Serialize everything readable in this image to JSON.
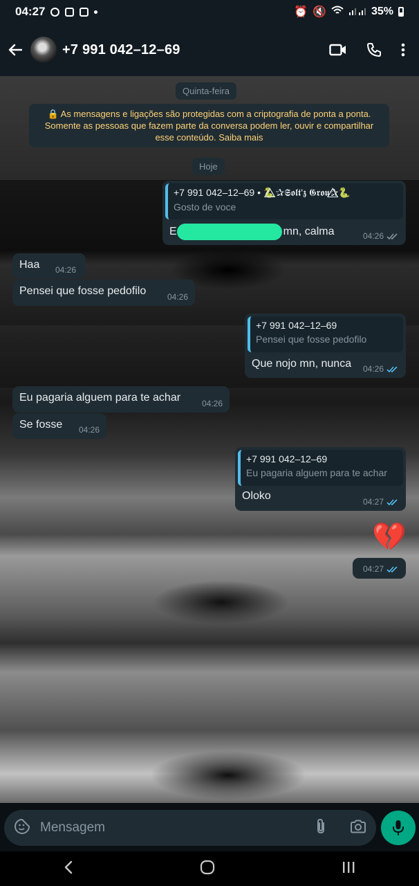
{
  "status": {
    "time": "04:27",
    "battery": "35%"
  },
  "header": {
    "contact_name": "+7 991 042–12–69"
  },
  "chat": {
    "day_label_1": "Quinta-feira",
    "encryption_notice": "🔒 As mensagens e ligações são protegidas com a criptografia de ponta a ponta. Somente as pessoas que fazem parte da conversa podem ler, ouvir e compartilhar esse conteúdo. Saiba mais",
    "day_label_2": "Hoje",
    "messages": [
      {
        "direction": "out",
        "quote_name": "+7 991 042–12–69 • 🐍⃤✰𝕾𝖔𝖑𝖙'𝖟 𝕲𝖗𝖔𝖚✰⃤🐍",
        "quote_text": "Gosto de voce",
        "text_start": "E",
        "text_end": "mn, calma",
        "time": "04:26",
        "read": false
      },
      {
        "direction": "in",
        "text": "Haa",
        "time": "04:26"
      },
      {
        "direction": "in",
        "text": "Pensei que fosse pedofilo",
        "time": "04:26"
      },
      {
        "direction": "out",
        "quote_name": "+7 991 042–12–69",
        "quote_text": "Pensei que fosse pedofilo",
        "text": "Que nojo mn, nunca",
        "time": "04:26",
        "read": true
      },
      {
        "direction": "in",
        "text": "Eu pagaria alguem para te achar",
        "time": "04:26"
      },
      {
        "direction": "in",
        "text": "Se fosse",
        "time": "04:26"
      },
      {
        "direction": "out",
        "quote_name": "+7 991 042–12–69",
        "quote_text": "Eu pagaria alguem para te achar",
        "text": "Oloko",
        "time": "04:27",
        "read": true
      },
      {
        "direction": "out",
        "emoji": "💔",
        "time": "04:27",
        "read": true
      }
    ]
  },
  "composer": {
    "placeholder": "Mensagem"
  },
  "colors": {
    "accent": "#00a884",
    "read_tick": "#53bdeb",
    "bubble": "#1f2c33",
    "notice_text": "#ffd279",
    "redaction": "#25e8a0"
  },
  "icons": [
    "back-arrow-icon",
    "video-call-icon",
    "voice-call-icon",
    "more-options-icon",
    "sticker-icon",
    "attach-icon",
    "camera-icon",
    "mic-icon",
    "nav-back-icon",
    "nav-home-icon",
    "nav-recents-icon"
  ]
}
